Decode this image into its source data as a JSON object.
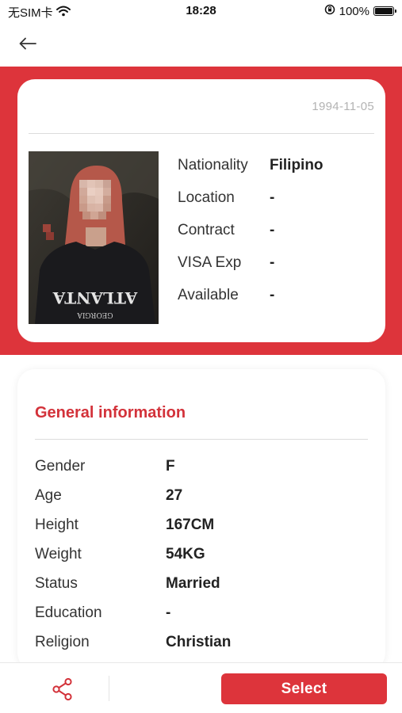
{
  "status_bar": {
    "carrier": "无SIM卡",
    "time": "18:28",
    "battery_percent": "100%",
    "battery_level": 1.0,
    "icons": [
      "wifi-icon",
      "orientation-lock-icon",
      "battery-icon"
    ]
  },
  "nav": {
    "back_icon": "back-arrow-icon"
  },
  "profile": {
    "birth_date": "1994-11-05",
    "photo_shirt_text": "ATLANTA",
    "photo_shirt_subtext": "GEORGIA",
    "rows": [
      {
        "label": "Nationality",
        "value": "Filipino"
      },
      {
        "label": "Location",
        "value": "-"
      },
      {
        "label": "Contract",
        "value": "-"
      },
      {
        "label": "VISA Exp",
        "value": "-"
      },
      {
        "label": "Available",
        "value": "-"
      }
    ]
  },
  "general": {
    "title": "General information",
    "rows": [
      {
        "label": "Gender",
        "value": "F"
      },
      {
        "label": "Age",
        "value": "27"
      },
      {
        "label": "Height",
        "value": "167CM"
      },
      {
        "label": "Weight",
        "value": "54KG"
      },
      {
        "label": "Status",
        "value": "Married"
      },
      {
        "label": "Education",
        "value": "-"
      },
      {
        "label": "Religion",
        "value": "Christian"
      }
    ]
  },
  "bottom_bar": {
    "share_icon": "share-icon",
    "select_label": "Select"
  },
  "colors": {
    "accent": "#dd343b",
    "title_red": "#d3323a",
    "muted_text": "#b3b3b3"
  }
}
